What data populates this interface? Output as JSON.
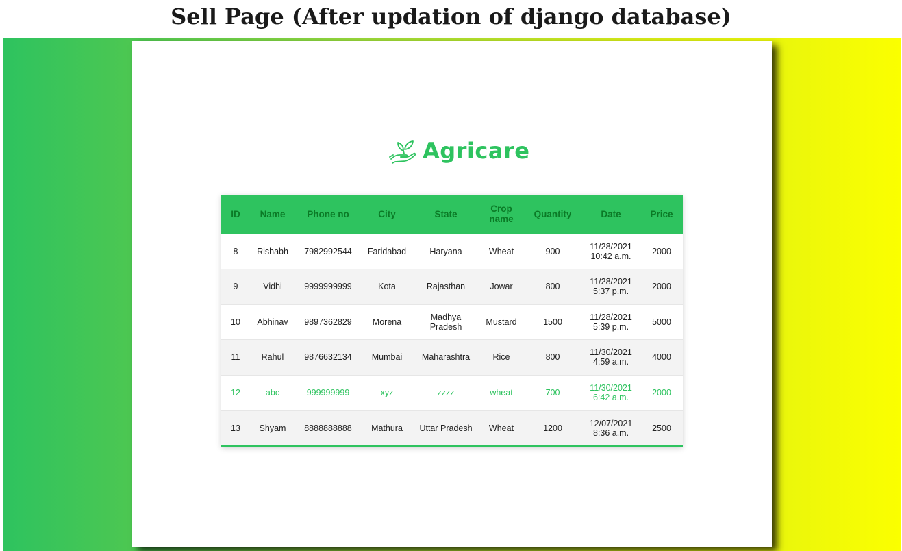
{
  "caption": "Sell Page (After updation of django database)",
  "logo": {
    "text": "Agricare",
    "icon": "plant-in-hand-icon"
  },
  "colors": {
    "brand": "#2ec35f",
    "header_text": "#0b7a26",
    "gradient_start": "#2ec35f",
    "gradient_end": "#fbff00"
  },
  "table": {
    "headers": [
      "ID",
      "Name",
      "Phone no",
      "City",
      "State",
      "Crop name",
      "Quantity",
      "Date",
      "Price"
    ],
    "rows": [
      {
        "id": "8",
        "name": "Rishabh",
        "phone": "7982992544",
        "city": "Faridabad",
        "state": "Haryana",
        "crop": "Wheat",
        "quantity": "900",
        "date": "11/28/2021",
        "time": "10:42 a.m.",
        "price": "2000"
      },
      {
        "id": "9",
        "name": "Vidhi",
        "phone": "9999999999",
        "city": "Kota",
        "state": "Rajasthan",
        "crop": "Jowar",
        "quantity": "800",
        "date": "11/28/2021",
        "time": "5:37 p.m.",
        "price": "2000"
      },
      {
        "id": "10",
        "name": "Abhinav",
        "phone": "9897362829",
        "city": "Morena",
        "state": "Madhya Pradesh",
        "crop": "Mustard",
        "quantity": "1500",
        "date": "11/28/2021",
        "time": "5:39 p.m.",
        "price": "5000"
      },
      {
        "id": "11",
        "name": "Rahul",
        "phone": "9876632134",
        "city": "Mumbai",
        "state": "Maharashtra",
        "crop": "Rice",
        "quantity": "800",
        "date": "11/30/2021",
        "time": "4:59 a.m.",
        "price": "4000"
      },
      {
        "id": "12",
        "name": "abc",
        "phone": "999999999",
        "city": "xyz",
        "state": "zzzz",
        "crop": "wheat",
        "quantity": "700",
        "date": "11/30/2021",
        "time": "6:42 a.m.",
        "price": "2000"
      },
      {
        "id": "13",
        "name": "Shyam",
        "phone": "8888888888",
        "city": "Mathura",
        "state": "Uttar Pradesh",
        "crop": "Wheat",
        "quantity": "1200",
        "date": "12/07/2021",
        "time": "8:36 a.m.",
        "price": "2500"
      }
    ]
  }
}
